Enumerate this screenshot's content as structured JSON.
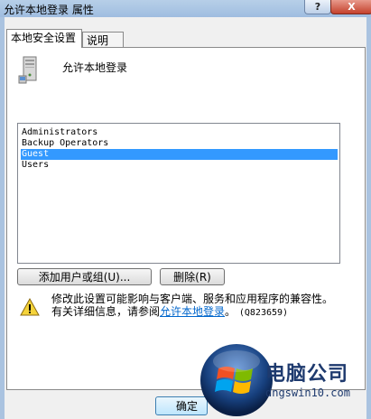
{
  "window": {
    "title": "允许本地登录 属性",
    "help_button": "?",
    "close_button": "X"
  },
  "tabs": [
    {
      "label": "本地安全设置",
      "active": true
    },
    {
      "label": "说明",
      "active": false
    }
  ],
  "policy": {
    "icon": "server-computer-icon",
    "name": "允许本地登录"
  },
  "members": {
    "items": [
      "Administrators",
      "Backup Operators",
      "Guest",
      "Users"
    ],
    "selected": "Guest"
  },
  "buttons": {
    "add": "添加用户或组(U)...",
    "remove": "删除(R)",
    "ok": "确定"
  },
  "warning": {
    "icon": "warning-triangle-icon",
    "line1": "修改此设置可能影响与客户端、服务和应用程序的兼容性。",
    "line2_prefix": "有关详细信息，请参阅",
    "link": "允许本地登录",
    "line2_suffix": "。",
    "kb": "(Q823659)"
  },
  "watermark": {
    "brand": "电脑公司",
    "url": "dngswin10.com",
    "logo": "windows-orb-logo"
  },
  "colors": {
    "selection": "#3399ff",
    "link": "#0066cc",
    "close": "#c4412c",
    "watermark_text": "#1e3a6e"
  }
}
